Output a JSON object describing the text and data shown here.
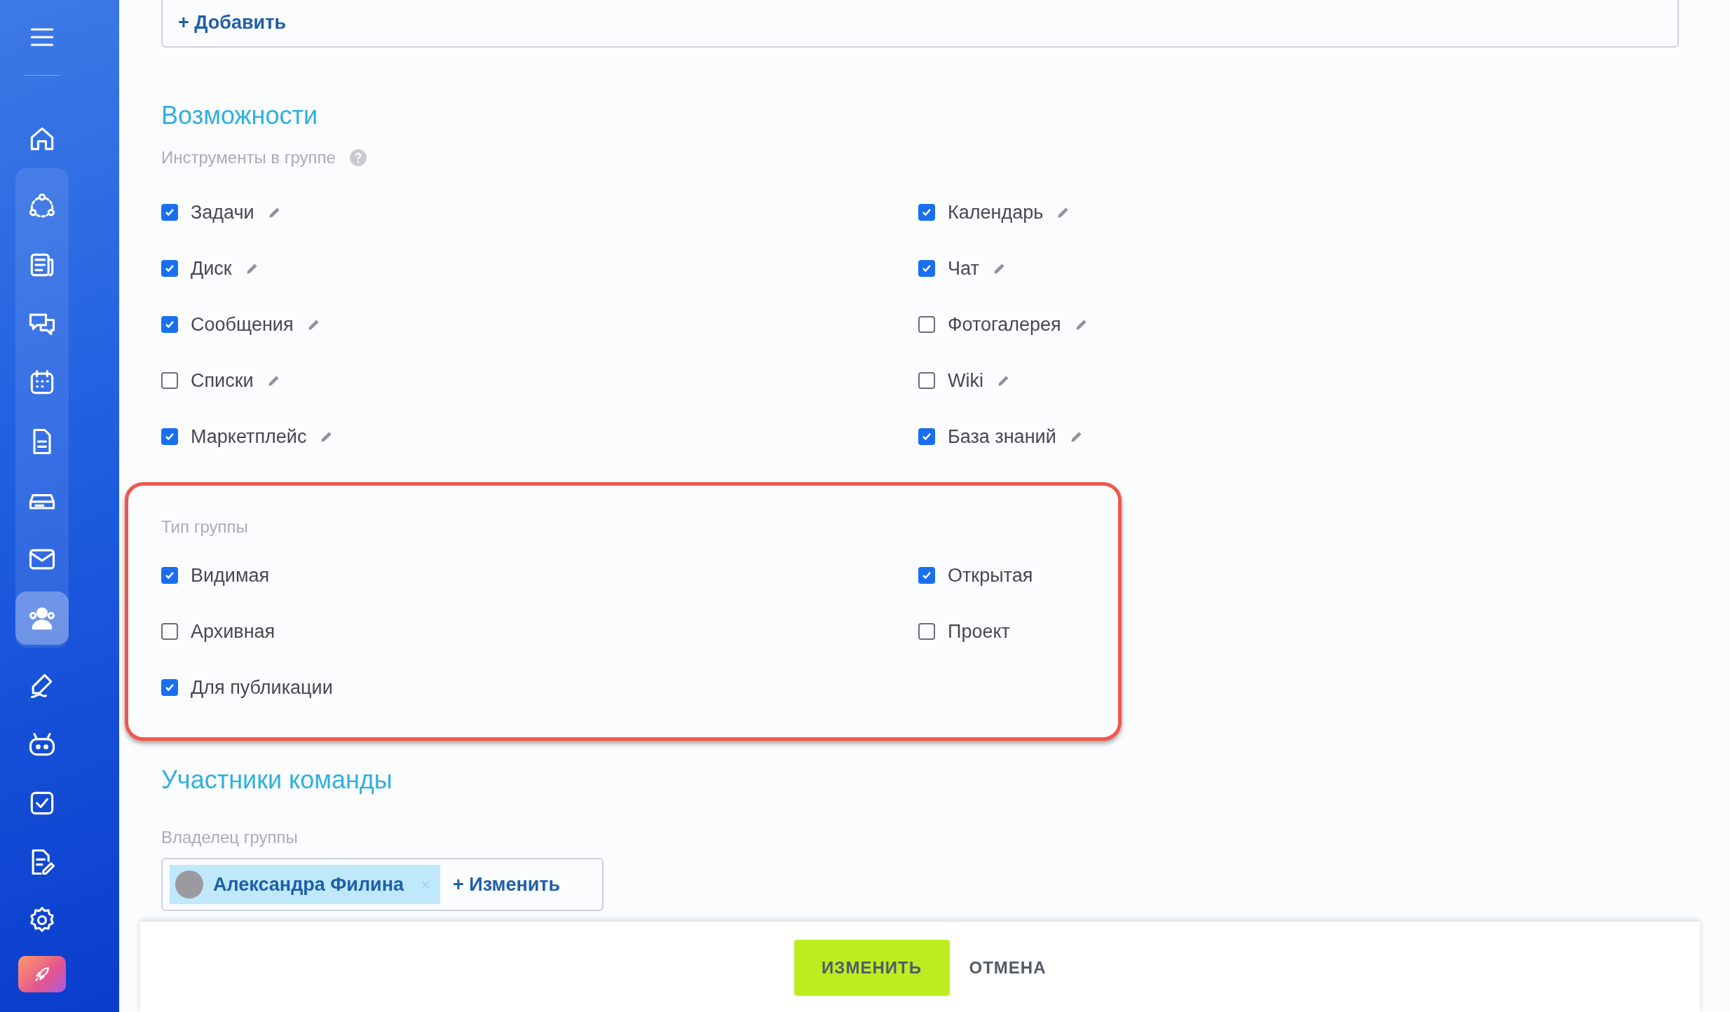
{
  "sidebar": {
    "home": [
      {
        "kind": "home",
        "selected": false
      }
    ],
    "pinned": [
      {
        "kind": "connections",
        "selected": false
      },
      {
        "kind": "news",
        "selected": false
      },
      {
        "kind": "chat",
        "selected": false
      },
      {
        "kind": "calendar",
        "selected": false
      },
      {
        "kind": "document",
        "selected": false
      },
      {
        "kind": "drive",
        "selected": false
      },
      {
        "kind": "mail",
        "selected": false
      },
      {
        "kind": "people",
        "selected": true
      }
    ],
    "tools": [
      {
        "kind": "pen",
        "selected": false
      },
      {
        "kind": "robot",
        "selected": false
      },
      {
        "kind": "task",
        "selected": false
      },
      {
        "kind": "edit-doc",
        "selected": false
      }
    ]
  },
  "add_button": "+ Добавить",
  "features": {
    "title": "Возможности",
    "label": "Инструменты в группе",
    "tools": [
      {
        "label": "Задачи",
        "checked": true
      },
      {
        "label": "Календарь",
        "checked": true
      },
      {
        "label": "Диск",
        "checked": true
      },
      {
        "label": "Чат",
        "checked": true
      },
      {
        "label": "Сообщения",
        "checked": true
      },
      {
        "label": "Фотогалерея",
        "checked": false
      },
      {
        "label": "Списки",
        "checked": false
      },
      {
        "label": "Wiki",
        "checked": false
      },
      {
        "label": "Маркетплейс",
        "checked": true
      },
      {
        "label": "База знаний",
        "checked": true
      }
    ]
  },
  "group_type": {
    "highlighted": true,
    "label": "Тип группы",
    "options": [
      {
        "label": "Видимая",
        "checked": true
      },
      {
        "label": "Открытая",
        "checked": true
      },
      {
        "label": "Архивная",
        "checked": false
      },
      {
        "label": "Проект",
        "checked": false
      },
      {
        "label": "Для публикации",
        "checked": true
      }
    ]
  },
  "members": {
    "title": "Участники команды",
    "owner_label": "Владелец группы",
    "owner_name": "Александра Филина",
    "change_link": "+ Изменить"
  },
  "footer": {
    "save": "ИЗМЕНИТЬ",
    "cancel": "ОТМЕНА"
  }
}
